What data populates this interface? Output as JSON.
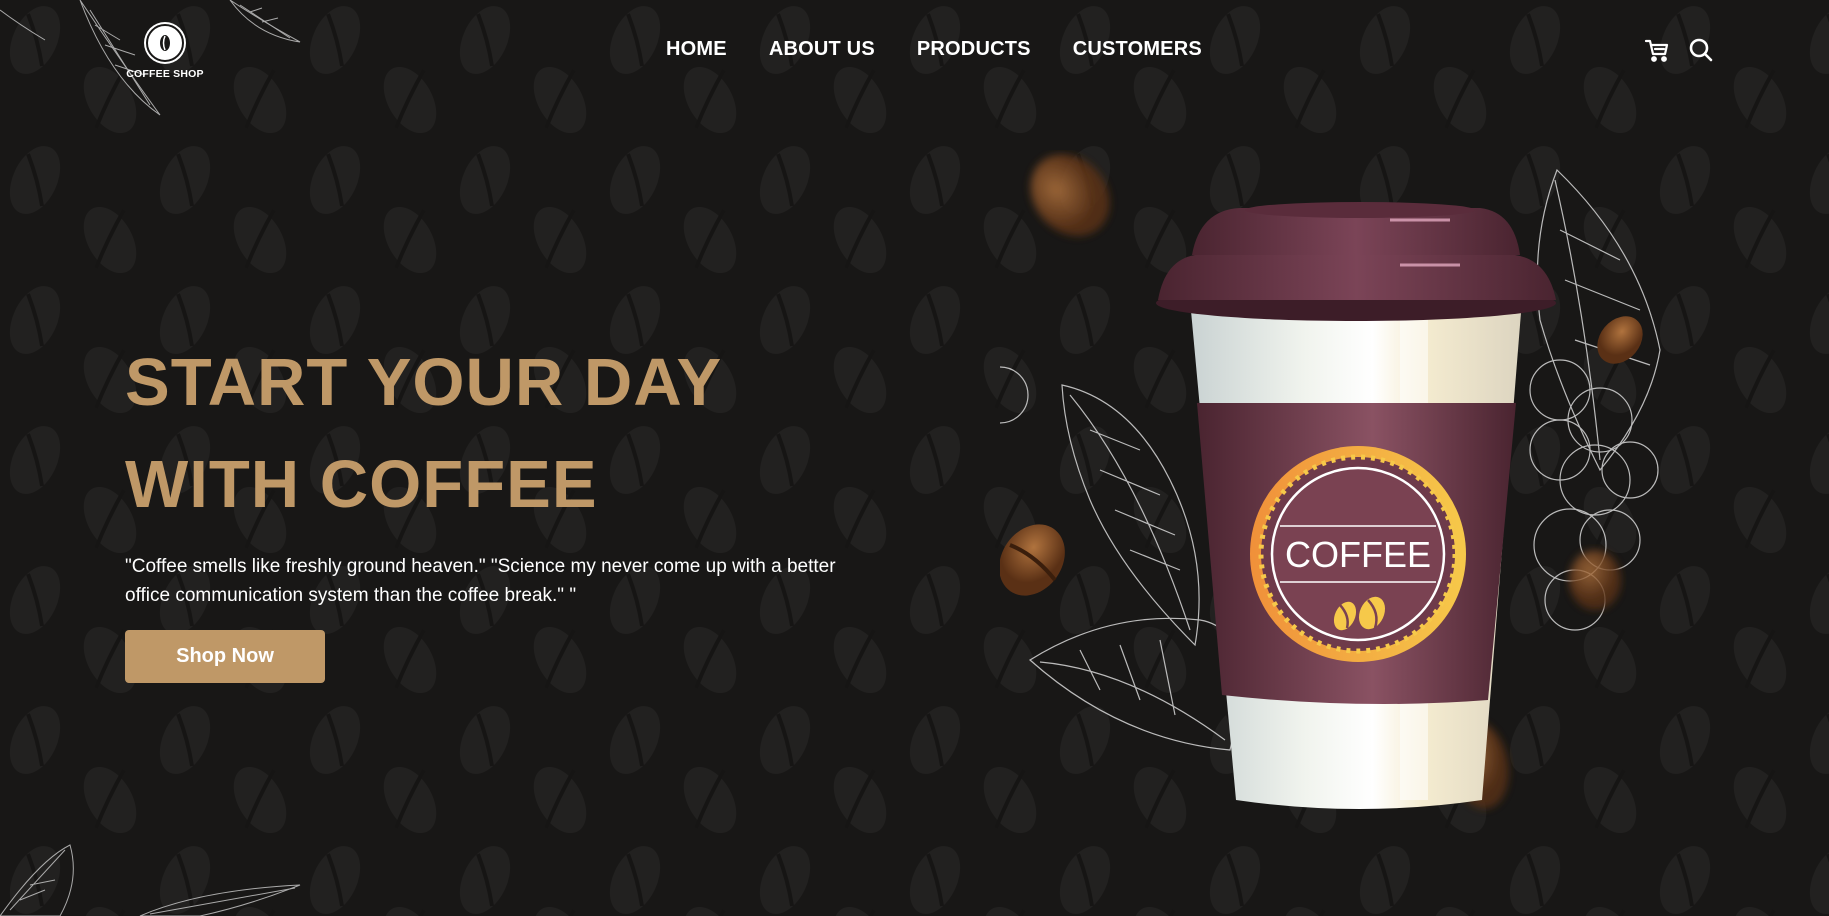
{
  "brand": {
    "name": "COFFEE SHOP"
  },
  "nav": {
    "items": [
      {
        "label": "HOME"
      },
      {
        "label": "ABOUT US"
      },
      {
        "label": "PRODUCTS"
      },
      {
        "label": "CUSTOMERS"
      }
    ]
  },
  "actions": {
    "icons": [
      "cart-icon",
      "search-icon"
    ]
  },
  "hero": {
    "headline_line1": "START YOUR DAY",
    "headline_line2": "WITH COFFEE",
    "quote": "\"Coffee smells like freshly ground heaven.\" \"Science my never come up with a better office communication system than the coffee break.\" \"",
    "cta_label": "Shop Now"
  },
  "product": {
    "cup_label": "COFFEE"
  },
  "colors": {
    "background": "#181716",
    "accent": "#bf9867",
    "cup_sleeve": "#6e3a4a",
    "text": "#ffffff"
  }
}
